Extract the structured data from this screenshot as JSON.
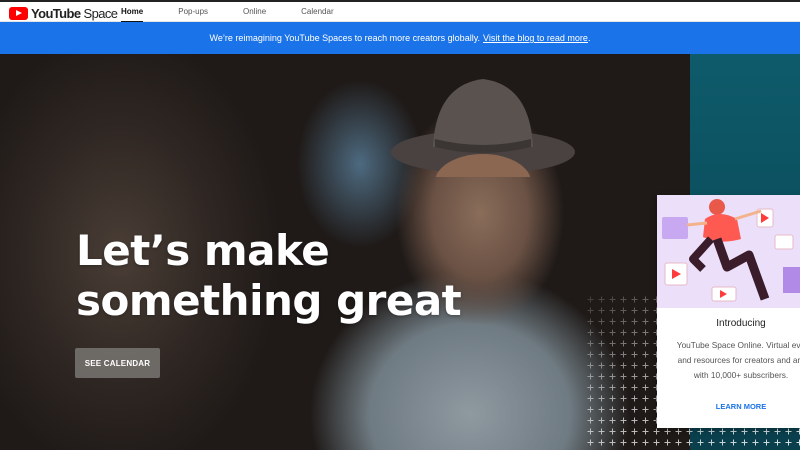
{
  "header": {
    "logo_text_bold": "YouTube",
    "logo_text_thin": " Space",
    "nav": [
      {
        "label": "Home",
        "active": true
      },
      {
        "label": "Pop-ups",
        "active": false
      },
      {
        "label": "Online",
        "active": false
      },
      {
        "label": "Calendar",
        "active": false
      }
    ]
  },
  "banner": {
    "text": "We’re reimagining YouTube Spaces to reach more creators globally.",
    "link_text": "Visit the blog to read more",
    "suffix": "."
  },
  "hero": {
    "title_line1": "Let’s make",
    "title_line2": "something great",
    "cta_label": "SEE CALENDAR"
  },
  "card": {
    "title": "Introducing",
    "body_line1": "YouTube Space Online. Virtual eve",
    "body_line2": "and resources for creators and arti",
    "body_line3": "with 10,000+ subscribers.",
    "link_label": "LEARN MORE"
  },
  "colors": {
    "banner_blue": "#1a73e8",
    "logo_red": "#ff0000",
    "link_blue": "#1a73e8",
    "card_art_bg": "#ecdffa",
    "teal_panel": "#0e5b6b"
  }
}
